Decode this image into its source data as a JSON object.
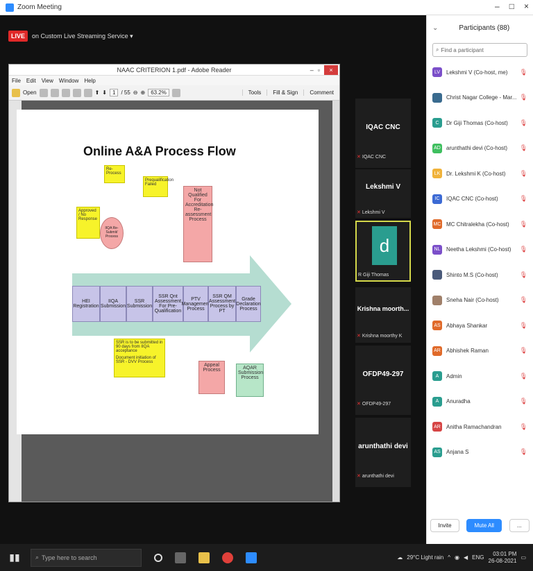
{
  "window": {
    "title": "Zoom Meeting",
    "controls": [
      "–",
      "□",
      "×"
    ]
  },
  "live": {
    "badge": "LIVE",
    "label": "on Custom Live Streaming Service ▾"
  },
  "reader": {
    "title": "NAAC CRITERION 1.pdf - Adobe Reader",
    "menu": [
      "File",
      "Edit",
      "View",
      "Window",
      "Help"
    ],
    "open_label": "Open",
    "page_current": "1",
    "page_total": "/ 55",
    "zoom": "63.2%",
    "tabs": [
      "Tools",
      "Fill & Sign",
      "Comment"
    ]
  },
  "slide": {
    "title": "Online A&A Process Flow",
    "callouts": {
      "top_left": "Re-Process",
      "prequal": "Prequalification Failed",
      "approved": "Approved / No Response",
      "ssr": "SSR is to be submitted in 90 days from IIQA acceptance",
      "dvv": "Document initiation of SSR - DVV Process"
    },
    "circle": "IIQA Re-Submit/ Process",
    "not_qualified": "Not Qualified For Accreditation Re-assessment Process",
    "steps": [
      "HEI Registration",
      "IIQA Submission",
      "SSR Submission",
      "SSR Qnt Assessment For Pre-Qualification",
      "PTV Management Process",
      "SSR QM Assessment Process by PT",
      "Grade Declaration Process"
    ],
    "appeal": "Appeal Process",
    "aqar": "AQAR Submission Process"
  },
  "tiles": [
    {
      "name": "IQAC CNC",
      "sub": "IQAC CNC"
    },
    {
      "name": "Lekshmi V",
      "sub": "Lekshmi V"
    },
    {
      "name": "d",
      "sub": "R Giji Thomas"
    },
    {
      "name": "Krishna moorth...",
      "sub": "Krishna moorthy K"
    },
    {
      "name": "OFDP49-297",
      "sub": "OFDP49-297"
    },
    {
      "name": "arunthathi devi",
      "sub": "arunthathi devi"
    }
  ],
  "panel": {
    "title": "Participants (88)",
    "search_placeholder": "Find a participant",
    "participants": [
      {
        "initials": "LV",
        "color": "#7b4fc9",
        "name": "Lekshmi V (Co-host, me)"
      },
      {
        "initials": "",
        "color": "#3a6b8f",
        "name": "Christ Nagar College - Mar... (Host)"
      },
      {
        "initials": "C",
        "color": "#2a9d8f",
        "name": "Dr Giji Thomas (Co-host)"
      },
      {
        "initials": "AD",
        "color": "#3fbf5f",
        "name": "arunthathi devi (Co-host)"
      },
      {
        "initials": "LK",
        "color": "#f0b23a",
        "name": "Dr. Lekshmi K (Co-host)"
      },
      {
        "initials": "IC",
        "color": "#3c6ad4",
        "name": "IQAC CNC (Co-host)"
      },
      {
        "initials": "MC",
        "color": "#e06a2a",
        "name": "MC Chitralekha (Co-host)"
      },
      {
        "initials": "NL",
        "color": "#7b4fc9",
        "name": "Neetha Lekshmi (Co-host)"
      },
      {
        "initials": "",
        "color": "#4a5a7a",
        "name": "Shinto M.S (Co-host)"
      },
      {
        "initials": "",
        "color": "#a0806a",
        "name": "Sneha Nair (Co-host)"
      },
      {
        "initials": "AS",
        "color": "#e06a2a",
        "name": "Abhaya Shankar"
      },
      {
        "initials": "AR",
        "color": "#e06a2a",
        "name": "Abhishek Raman"
      },
      {
        "initials": "A",
        "color": "#2a9d8f",
        "name": "Admin"
      },
      {
        "initials": "A",
        "color": "#2a9d8f",
        "name": "Anuradha"
      },
      {
        "initials": "AR",
        "color": "#d64545",
        "name": "Anitha Ramachandran"
      },
      {
        "initials": "AS",
        "color": "#2a9d8f",
        "name": "Anjana S"
      }
    ],
    "buttons": [
      "Invite",
      "Mute All",
      "..."
    ]
  },
  "taskbar": {
    "search_placeholder": "Type here to search",
    "weather": "29°C Light rain",
    "lang": "ENG",
    "time": "03:01 PM",
    "date": "26-08-2021"
  }
}
